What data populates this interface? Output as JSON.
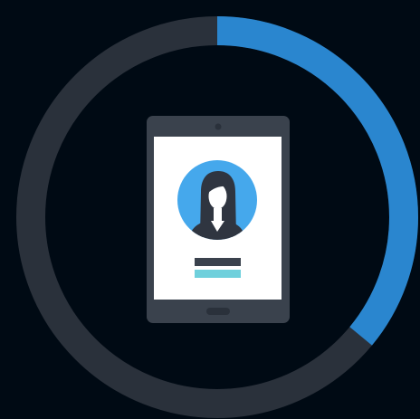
{
  "progress": {
    "fraction": 0.36
  },
  "colors": {
    "background": "#000a14",
    "ring_track": "#2a313b",
    "ring_progress": "#2a86cf",
    "tablet_body": "#3a424d",
    "tablet_camera": "#2a313b",
    "screen": "#ffffff",
    "avatar_circle": "#45a8ec",
    "avatar_hair": "#2f3540",
    "avatar_skin": "#ffffff",
    "avatar_shirt": "#2f3540",
    "name_bar": "#3a424d",
    "subtitle_bar": "#6fd0dc",
    "home_button": "#2a313b"
  },
  "icons": {
    "device": "tablet-icon",
    "avatar": "user-avatar-icon"
  }
}
